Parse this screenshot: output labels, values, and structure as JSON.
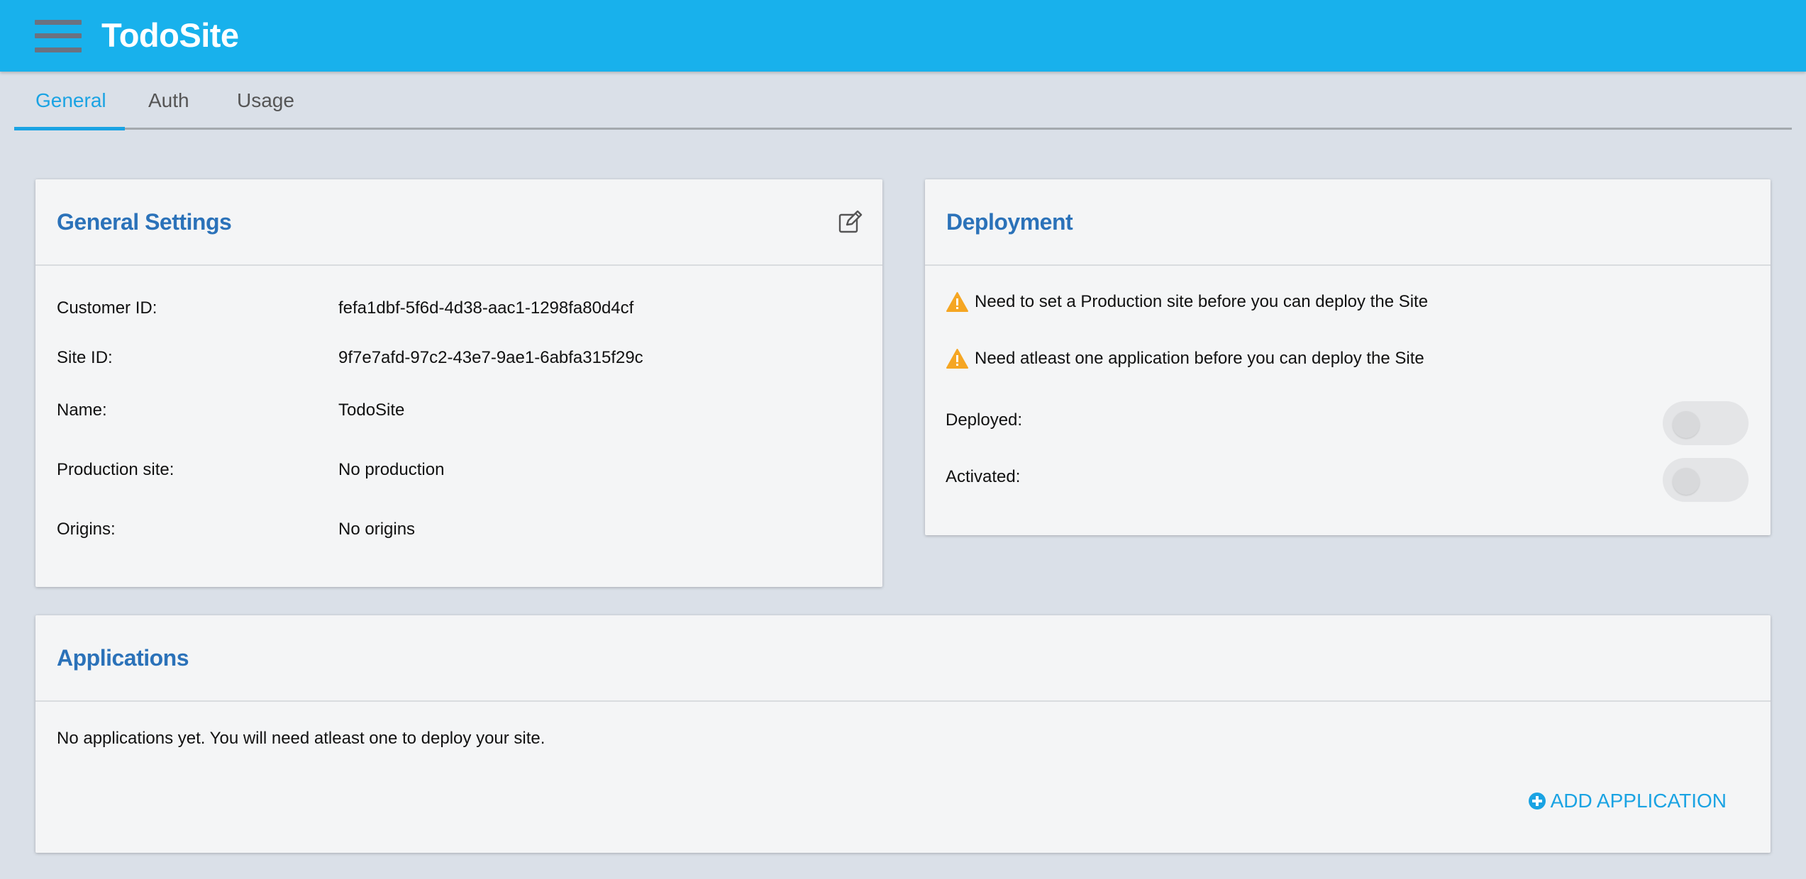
{
  "header": {
    "title": "TodoSite"
  },
  "tabs": [
    {
      "label": "General"
    },
    {
      "label": "Auth"
    },
    {
      "label": "Usage"
    }
  ],
  "general_settings": {
    "title": "General Settings",
    "rows": [
      {
        "label": "Customer ID:",
        "value": "fefa1dbf-5f6d-4d38-aac1-1298fa80d4cf"
      },
      {
        "label": "Site ID:",
        "value": "9f7e7afd-97c2-43e7-9ae1-6abfa315f29c"
      },
      {
        "label": "Name:",
        "value": "TodoSite"
      },
      {
        "label": "Production site:",
        "value": "No production"
      },
      {
        "label": "Origins:",
        "value": "No origins"
      }
    ]
  },
  "deployment": {
    "title": "Deployment",
    "warnings": [
      "Need to set a Production site before you can deploy the Site",
      "Need atleast one application before you can deploy the Site"
    ],
    "deployed_label": "Deployed:",
    "deployed": false,
    "activated_label": "Activated:",
    "activated": false
  },
  "applications": {
    "title": "Applications",
    "empty_text": "No applications yet. You will need atleast one to deploy your site.",
    "add_label": "ADD APPLICATION"
  },
  "colors": {
    "topbar": "#18b1ec",
    "accent": "#1aa3e3",
    "card_title": "#2b72b9",
    "warning": "#f5a623"
  }
}
